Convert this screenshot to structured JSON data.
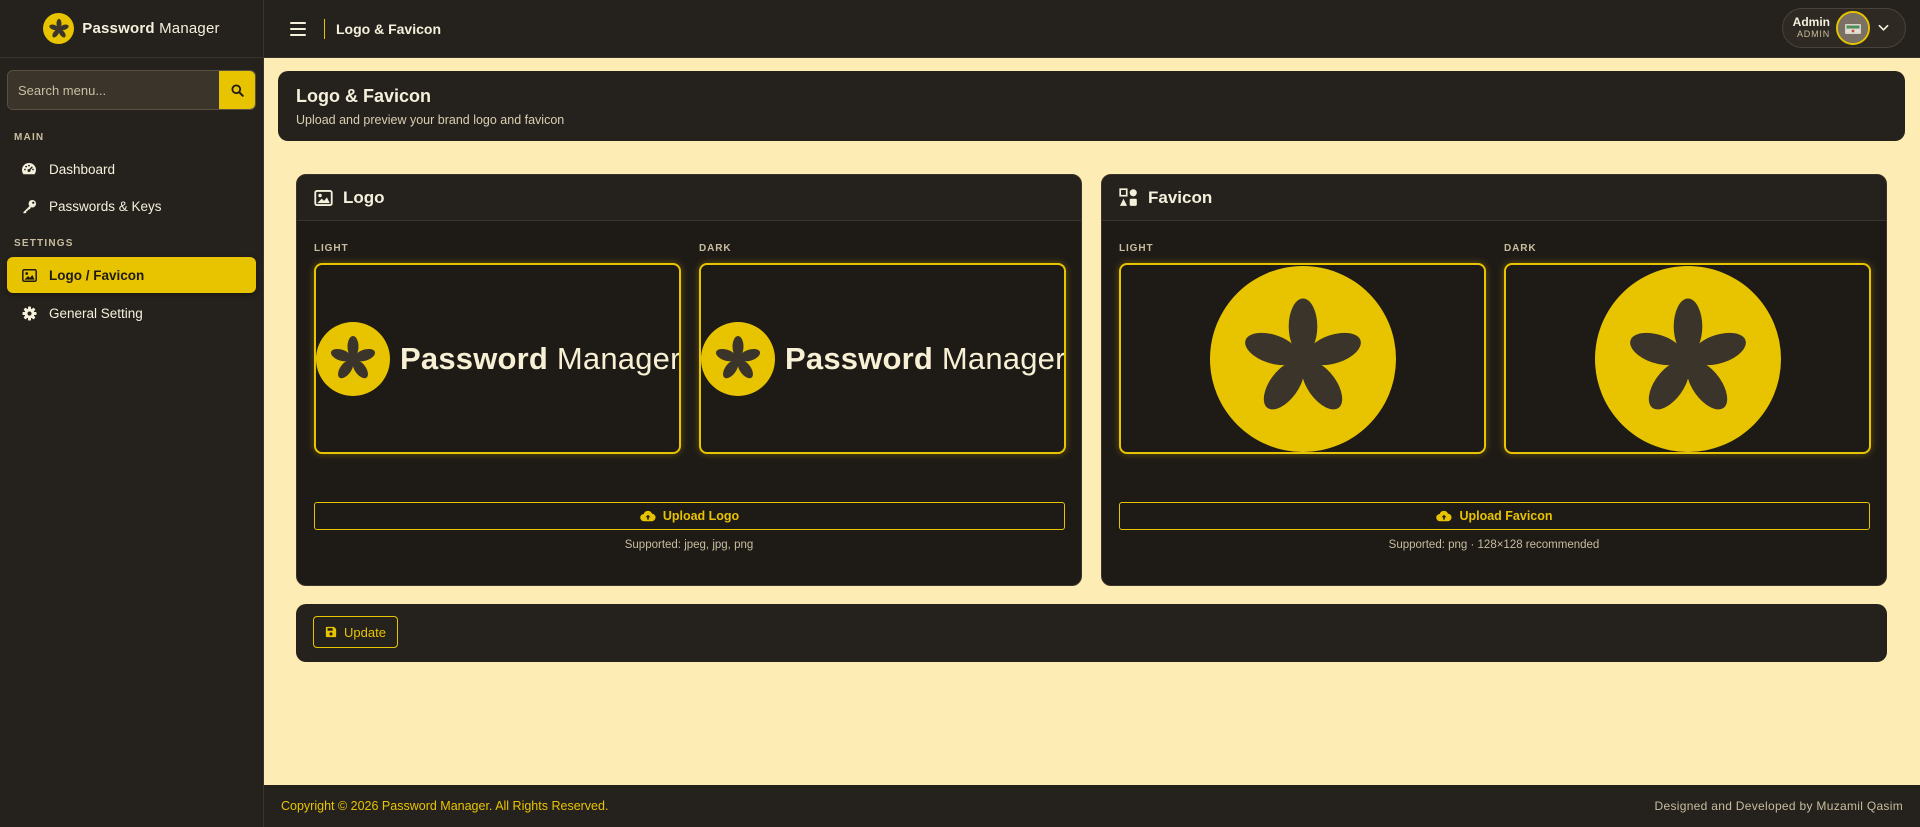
{
  "brand": {
    "name_bold": "Password",
    "name_light": "Manager"
  },
  "sidebar": {
    "search_placeholder": "Search menu...",
    "sections": [
      {
        "label": "MAIN",
        "items": [
          {
            "label": "Dashboard",
            "icon": "dashboard-gauge-icon"
          },
          {
            "label": "Passwords & Keys",
            "icon": "key-icon"
          }
        ]
      },
      {
        "label": "SETTINGS",
        "items": [
          {
            "label": "Logo / Favicon",
            "icon": "image-icon",
            "active": true
          },
          {
            "label": "General Setting",
            "icon": "gear-icon"
          }
        ]
      }
    ]
  },
  "topbar": {
    "title": "Logo & Favicon",
    "user": {
      "name": "Admin",
      "role": "ADMIN"
    }
  },
  "page": {
    "title": "Logo & Favicon",
    "subtitle": "Upload and preview your brand logo and favicon"
  },
  "logo_card": {
    "title": "Logo",
    "light_label": "LIGHT",
    "dark_label": "DARK",
    "upload_label": "Upload Logo",
    "supported": "Supported: jpeg, jpg, png"
  },
  "favicon_card": {
    "title": "Favicon",
    "light_label": "LIGHT",
    "dark_label": "DARK",
    "upload_label": "Upload Favicon",
    "supported": "Supported: png · 128×128 recommended"
  },
  "update_label": "Update",
  "footer": {
    "copyright": "Copyright © 2026 Password Manager. All Rights Reserved.",
    "credit": "Designed and Developed by Muzamil Qasim"
  },
  "colors": {
    "accent": "#e8c400",
    "panel": "#25211c",
    "page_bg": "#fdedb4"
  }
}
